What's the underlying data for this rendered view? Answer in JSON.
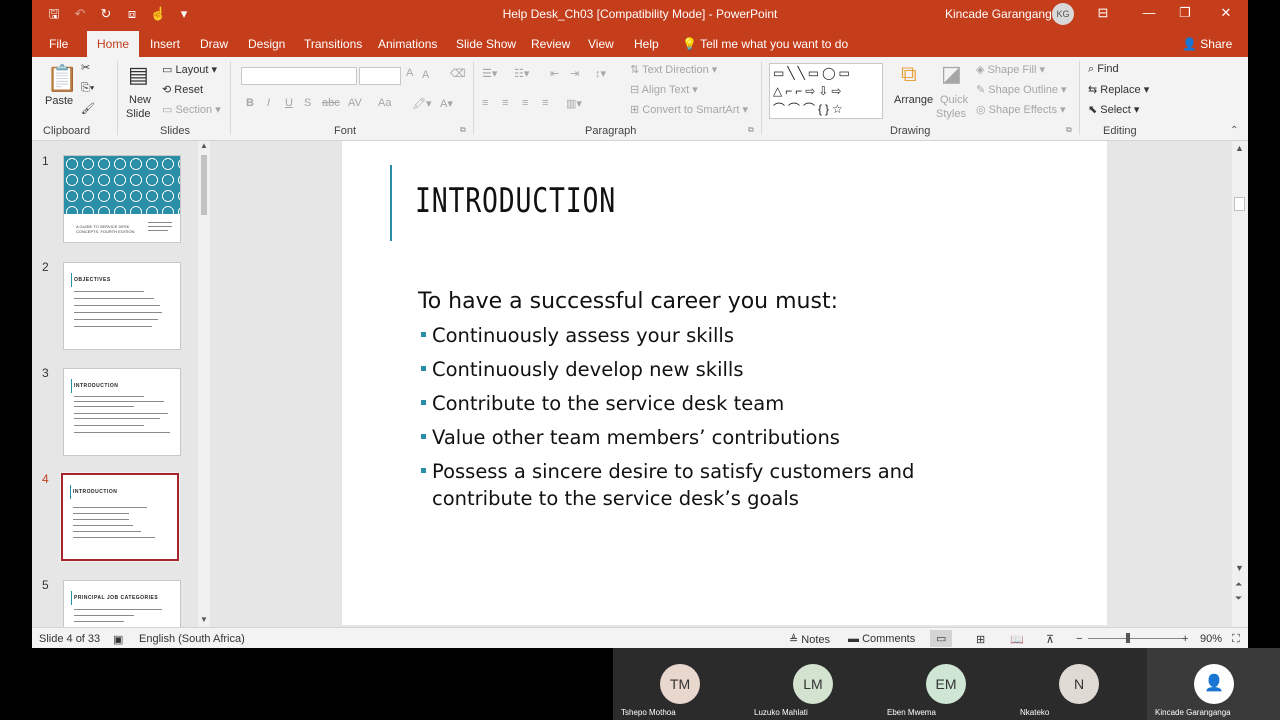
{
  "titlebar": {
    "document_title": "Help Desk_Ch03 [Compatibility Mode]  -  PowerPoint",
    "user_name": "Kincade Garanganga",
    "user_initials": "KG"
  },
  "tabs": {
    "items": [
      "File",
      "Home",
      "Insert",
      "Draw",
      "Design",
      "Transitions",
      "Animations",
      "Slide Show",
      "Review",
      "View",
      "Help"
    ],
    "active": "Home",
    "tell_me": "Tell me what you want to do",
    "share": "Share"
  },
  "ribbon": {
    "clipboard": {
      "paste": "Paste",
      "label": "Clipboard"
    },
    "slides": {
      "new_slide_1": "New",
      "new_slide_2": "Slide",
      "layout": "Layout",
      "reset": "Reset",
      "section": "Section",
      "label": "Slides"
    },
    "font": {
      "bold": "B",
      "italic": "I",
      "underline": "U",
      "strike": "S",
      "spacing": "AV",
      "case": "Aa",
      "label": "Font"
    },
    "paragraph": {
      "text_direction": "Text Direction",
      "align_text": "Align Text",
      "convert_smartart": "Convert to SmartArt",
      "label": "Paragraph"
    },
    "drawing": {
      "arrange": "Arrange",
      "quick_styles_1": "Quick",
      "quick_styles_2": "Styles",
      "shape_fill": "Shape Fill",
      "shape_outline": "Shape Outline",
      "shape_effects": "Shape Effects",
      "label": "Drawing",
      "shape_glyphs": "▭╲╲▭◯▭ △⌐⌐⇨⇩⇨ ⌒⌒⌒{}☆"
    },
    "editing": {
      "find": "Find",
      "replace": "Replace",
      "select": "Select",
      "label": "Editing"
    }
  },
  "thumbnails": [
    {
      "num": "1",
      "title": "A GUIDE TO SERVICE DESK CONCEPTS, FOURTH EDITION"
    },
    {
      "num": "2",
      "title": "OBJECTIVES"
    },
    {
      "num": "3",
      "title": "INTRODUCTION"
    },
    {
      "num": "4",
      "title": "INTRODUCTION"
    },
    {
      "num": "5",
      "title": "PRINCIPAL JOB CATEGORIES"
    }
  ],
  "slide": {
    "title": "INTRODUCTION",
    "lead": "To have a successful career you must:",
    "bullets": [
      "Continuously assess your skills",
      "Continuously develop new skills",
      "Contribute to the service desk team",
      "Value other team members’ contributions",
      "Possess a sincere desire to satisfy customers and contribute to the service desk’s goals"
    ]
  },
  "status": {
    "slide_counter": "Slide 4 of 33",
    "language": "English (South Africa)",
    "notes": "Notes",
    "comments": "Comments",
    "zoom": "90%"
  },
  "meeting": {
    "participants": [
      {
        "initials": "TM",
        "name": "Tshepo Mothoa"
      },
      {
        "initials": "LM",
        "name": "Luzuko Mahlati"
      },
      {
        "initials": "EM",
        "name": "Eben Mwema"
      },
      {
        "initials": "N",
        "name": "Nkateko"
      },
      {
        "initials": "",
        "name": "Kincade Garanganga"
      }
    ]
  },
  "colors": {
    "accent": "#c43e1c",
    "slide_accent": "#2a8fa6",
    "active_thumb_border": "#a4262c"
  }
}
